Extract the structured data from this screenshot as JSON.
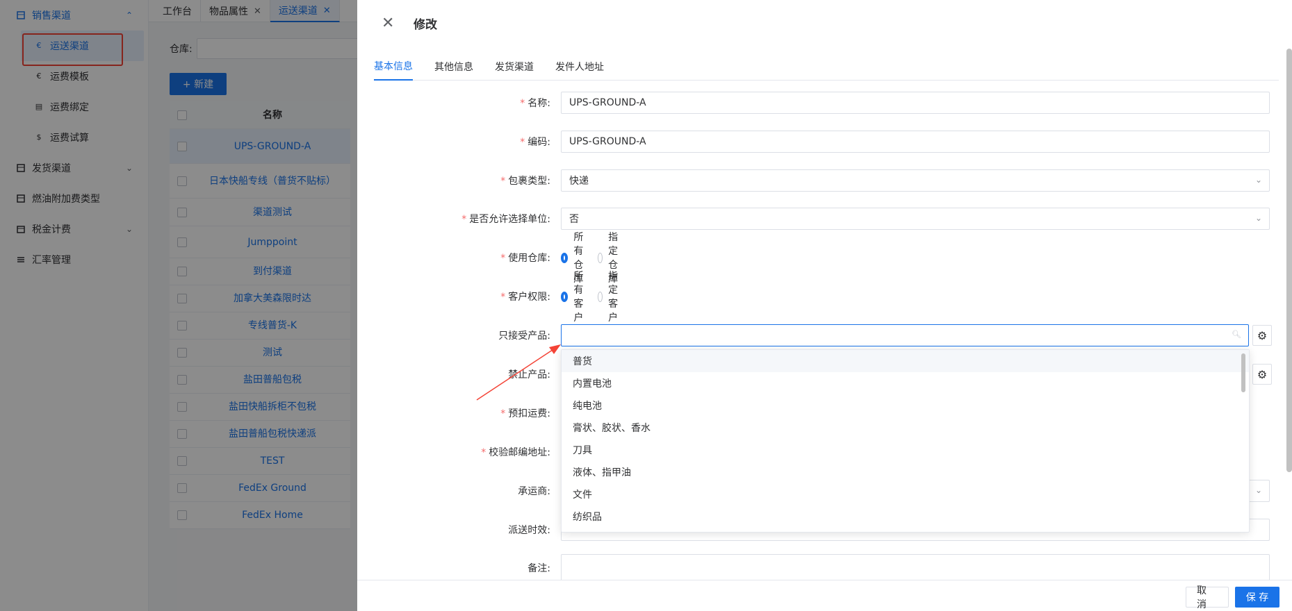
{
  "sidebar": {
    "groups": [
      {
        "label": "销售渠道",
        "icon": "table-icon",
        "expanded": true,
        "chevron": "⌃"
      },
      {
        "label": "发货渠道",
        "icon": "table-icon",
        "chevron": "⌄"
      },
      {
        "label": "燃油附加费类型",
        "icon": "table-icon"
      },
      {
        "label": "税金计费",
        "icon": "calendar-icon",
        "chevron": "⌄"
      },
      {
        "label": "汇率管理",
        "icon": "list-icon"
      }
    ],
    "sub_items": [
      {
        "label": "运送渠道",
        "icon": "€"
      },
      {
        "label": "运费模板",
        "icon": "€"
      },
      {
        "label": "运费绑定",
        "icon": "▤"
      },
      {
        "label": "运费试算",
        "icon": "$"
      }
    ]
  },
  "page_tabs": [
    {
      "label": "工作台"
    },
    {
      "label": "物品属性",
      "close": "✕"
    },
    {
      "label": "运送渠道",
      "close": "✕"
    }
  ],
  "filter": {
    "label": "仓库:"
  },
  "new_button": "+ 新建",
  "table": {
    "header": "名称",
    "rows": [
      "UPS-GROUND-A",
      "日本快船专线（普货不贴标）",
      "渠道测试",
      "Jumppoint",
      "到付渠道",
      "加拿大美森限时达",
      "专线普货-K",
      "测试",
      "盐田普船包税",
      "盐田快船拆柜不包税",
      "盐田普船包税快递派",
      "TEST",
      "FedEx Ground",
      "FedEx Home"
    ]
  },
  "drawer": {
    "close_icon": "✕",
    "title": "修改",
    "tabs": [
      "基本信息",
      "其他信息",
      "发货渠道",
      "发件人地址"
    ],
    "fields": {
      "name": {
        "label": "名称:",
        "value": "UPS-GROUND-A"
      },
      "code": {
        "label": "编码:",
        "value": "UPS-GROUND-A"
      },
      "package_type": {
        "label": "包裹类型:",
        "value": "快递"
      },
      "allow_unit": {
        "label": "是否允许选择单位:",
        "value": "否"
      },
      "warehouse": {
        "label": "使用仓库:",
        "options": [
          "所有仓库",
          "指定仓库"
        ],
        "selected": "所有仓库"
      },
      "customer": {
        "label": "客户权限:",
        "options": [
          "所有客户",
          "指定客户"
        ],
        "selected": "所有客户"
      },
      "accept_products": {
        "label": "只接受产品:",
        "value": ""
      },
      "forbid_products": {
        "label": "禁止产品:"
      },
      "prepaid_freight": {
        "label": "预扣运费:"
      },
      "zip_check": {
        "label": "校验邮编地址:"
      },
      "carrier": {
        "label": "承运商:"
      },
      "delivery_time": {
        "label": "派送时效:"
      },
      "remark": {
        "label": "备注:"
      }
    },
    "dropdown_options": [
      "普货",
      "内置电池",
      "纯电池",
      "膏状、胶状、香水",
      "刀具",
      "液体、指甲油",
      "文件",
      "纺织品"
    ]
  },
  "footer": {
    "cancel": "取 消",
    "save": "保 存"
  },
  "colors": {
    "primary": "#1a73e8",
    "required": "#f56c6c",
    "annotation": "#f44336"
  }
}
